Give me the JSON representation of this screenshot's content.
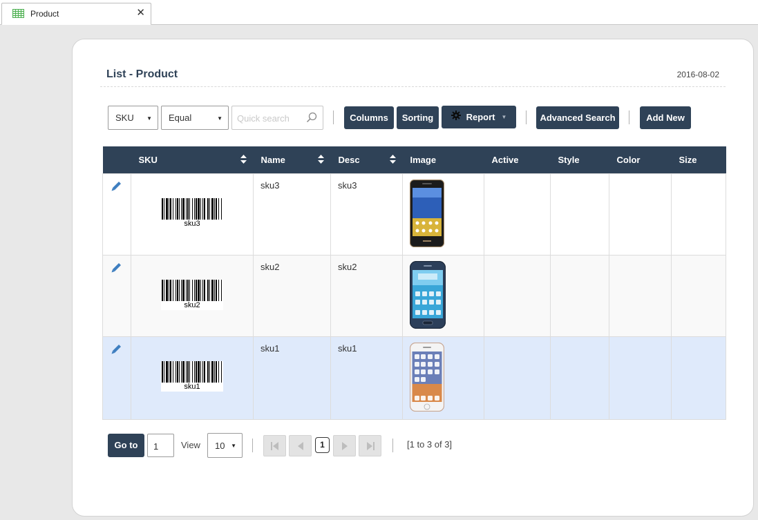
{
  "tab": {
    "title": "Product",
    "icon": "table-grid-icon"
  },
  "header": {
    "title": "List - Product",
    "date": "2016-08-02"
  },
  "toolbar": {
    "field_select": "SKU",
    "operator_select": "Equal",
    "search_placeholder": "Quick search",
    "columns_label": "Columns",
    "sorting_label": "Sorting",
    "report_label": "Report",
    "advanced_search_label": "Advanced Search",
    "add_new_label": "Add New"
  },
  "table": {
    "columns": [
      "SKU",
      "Name",
      "Desc",
      "Image",
      "Active",
      "Style",
      "Color",
      "Size"
    ],
    "rows": [
      {
        "barcode_text": "sku3",
        "name": "sku3",
        "desc": "sku3",
        "image": "phone-lg-icon",
        "active": "",
        "style": "",
        "color": "",
        "size": ""
      },
      {
        "barcode_text": "sku2",
        "name": "sku2",
        "desc": "sku2",
        "image": "phone-samsung-icon",
        "active": "",
        "style": "",
        "color": "",
        "size": ""
      },
      {
        "barcode_text": "sku1",
        "name": "sku1",
        "desc": "sku1",
        "image": "phone-iphone-icon",
        "active": "",
        "style": "",
        "color": "",
        "size": ""
      }
    ],
    "selected_row": 3
  },
  "pagination": {
    "goto_label": "Go to",
    "goto_value": "1",
    "view_label": "View",
    "page_size": "10",
    "current_page": "1",
    "info": "[1 to 3 of 3]"
  },
  "colors": {
    "accent": "#2f4257",
    "selected_row": "#dfeafb",
    "pencil": "#3f7fc0"
  }
}
